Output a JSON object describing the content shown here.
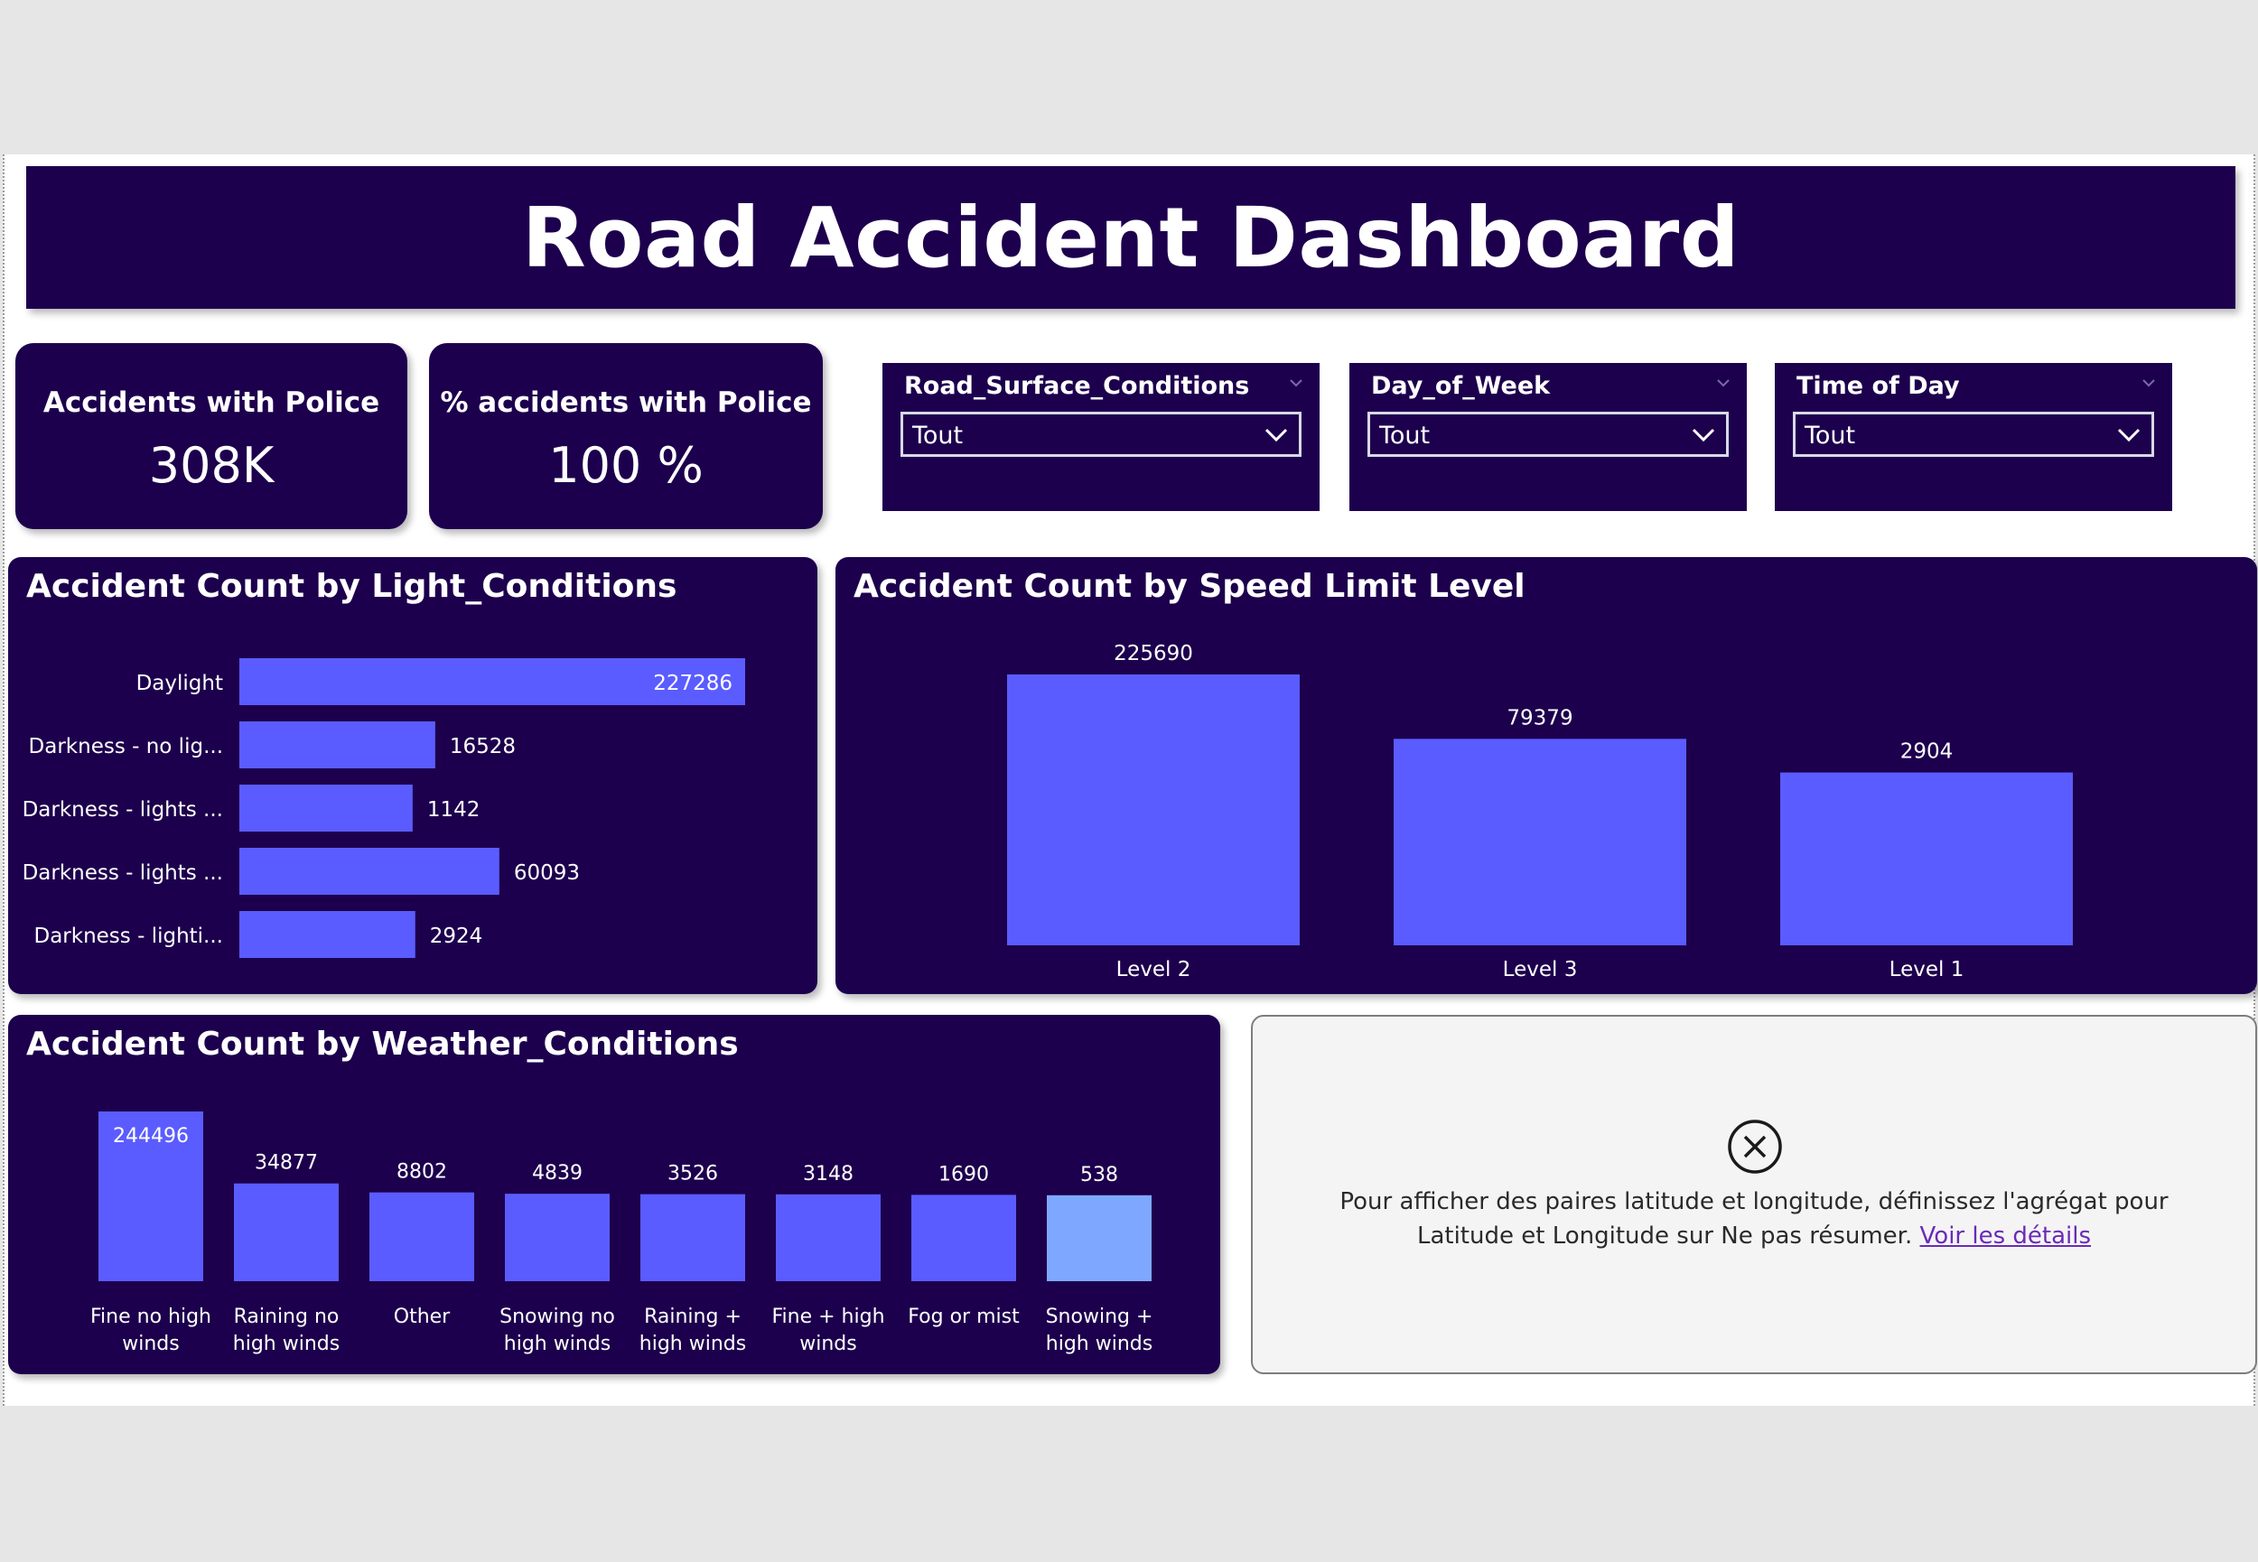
{
  "header": {
    "title": "Road Accident Dashboard"
  },
  "kpis": [
    {
      "label": "Accidents with Police",
      "value": "308K"
    },
    {
      "label": "% accidents with Police",
      "value": "100 %"
    }
  ],
  "slicers": [
    {
      "label": "Road_Surface_Conditions",
      "value": "Tout"
    },
    {
      "label": "Day_of_Week",
      "value": "Tout"
    },
    {
      "label": "Time of Day",
      "value": "Tout"
    }
  ],
  "charts": {
    "light": {
      "title": "Accident Count by Light_Conditions"
    },
    "speed": {
      "title": "Accident Count by Speed Limit Level"
    },
    "weather": {
      "title": "Accident Count by Weather_Conditions"
    }
  },
  "map_notice": {
    "message": "Pour afficher des paires latitude et longitude, définissez l'agrégat pour Latitude et Longitude sur Ne pas résumer.",
    "link": "Voir les détails",
    "icon": "close-circle-icon"
  },
  "colors": {
    "panel": "#1d004d",
    "bar": "#5b5cff",
    "bar_highlight": "#7ea8ff",
    "text": "#ffffff"
  },
  "chart_data": [
    {
      "type": "bar",
      "orientation": "horizontal",
      "title": "Accident Count by Light_Conditions",
      "categories": [
        "Daylight",
        "Darkness - no lig...",
        "Darkness - lights ...",
        "Darkness - lights ...",
        "Darkness - lighti..."
      ],
      "values": [
        227286,
        16528,
        1142,
        60093,
        2924
      ]
    },
    {
      "type": "bar",
      "title": "Accident Count by Speed Limit Level",
      "categories": [
        "Level 2",
        "Level 3",
        "Level 1"
      ],
      "values": [
        225690,
        79379,
        2904
      ]
    },
    {
      "type": "bar",
      "title": "Accident Count by Weather_Conditions",
      "categories": [
        "Fine no high winds",
        "Raining no high winds",
        "Other",
        "Snowing no high winds",
        "Raining + high winds",
        "Fine + high winds",
        "Fog or mist",
        "Snowing + high winds"
      ],
      "values": [
        244496,
        34877,
        8802,
        4839,
        3526,
        3148,
        1690,
        538
      ],
      "highlighted_index": 7
    }
  ]
}
